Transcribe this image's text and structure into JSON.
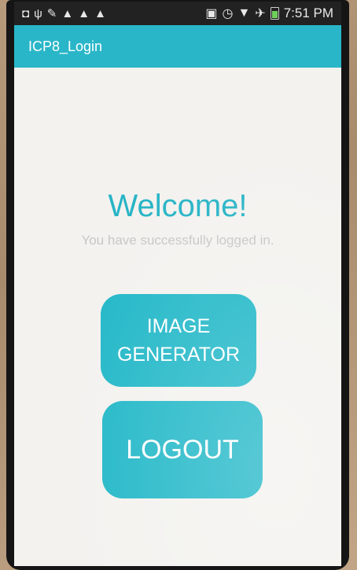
{
  "status_bar": {
    "time": "7:51 PM",
    "left_icons": [
      "notification-icon",
      "usb-icon",
      "wrench-icon",
      "warning-icon",
      "warning-icon",
      "warning-icon"
    ],
    "right_icons": [
      "nfc-icon",
      "alarm-icon",
      "wifi-icon",
      "airplane-icon",
      "battery-icon"
    ]
  },
  "app_bar": {
    "title": "ICP8_Login"
  },
  "main": {
    "welcome": "Welcome!",
    "subtitle": "You have successfully logged in.",
    "image_generator_label": "IMAGE GENERATOR",
    "logout_label": "LOGOUT"
  },
  "colors": {
    "accent": "#29b6c8",
    "button": "#23b8c8",
    "background": "#f3f2ef",
    "subtitle_text": "#c7c7c7"
  }
}
